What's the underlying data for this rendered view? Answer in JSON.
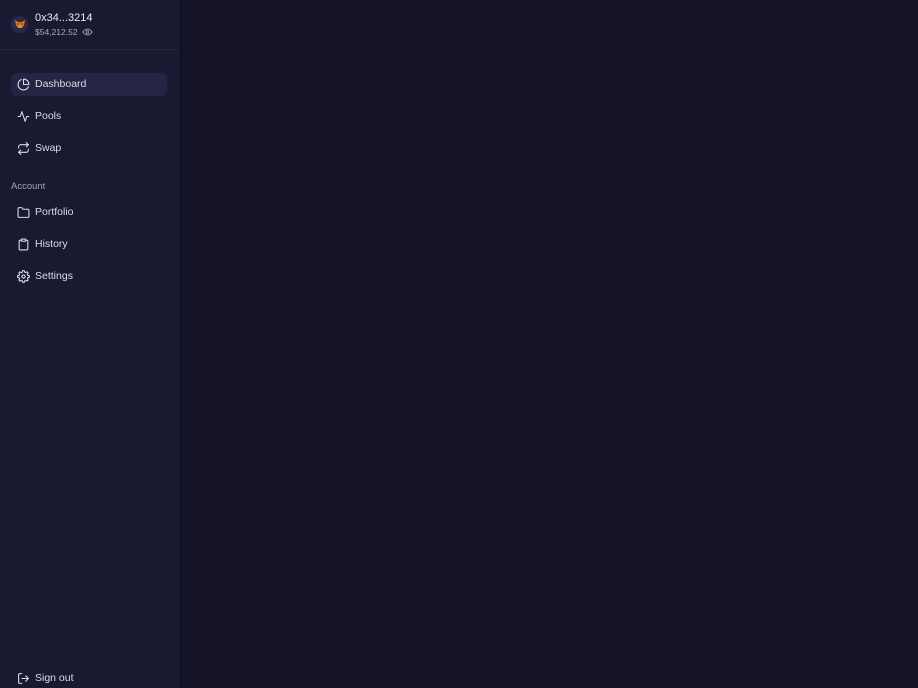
{
  "wallet": {
    "address": "0x34...3214",
    "balance": "$54,212.52",
    "avatar_icon": "fox-icon",
    "visibility_icon": "eye-icon"
  },
  "nav": {
    "primary": [
      {
        "label": "Dashboard",
        "icon": "pie-chart-icon",
        "active": true
      },
      {
        "label": "Pools",
        "icon": "activity-icon",
        "active": false
      },
      {
        "label": "Swap",
        "icon": "swap-arrows-icon",
        "active": false
      }
    ],
    "account_section_label": "Account",
    "account": [
      {
        "label": "Portfolio",
        "icon": "folder-icon"
      },
      {
        "label": "History",
        "icon": "clipboard-icon"
      },
      {
        "label": "Settings",
        "icon": "gear-icon"
      }
    ],
    "sign_out_label": "Sign out",
    "sign_out_icon": "log-out-icon"
  },
  "colors": {
    "sidebar_bg": "#1a1932",
    "main_bg": "#131227",
    "active_item_bg": "#252444",
    "text_primary": "#e6e6f0",
    "text_muted": "#a3a2bc",
    "avatar_accent": "#e2761b"
  }
}
